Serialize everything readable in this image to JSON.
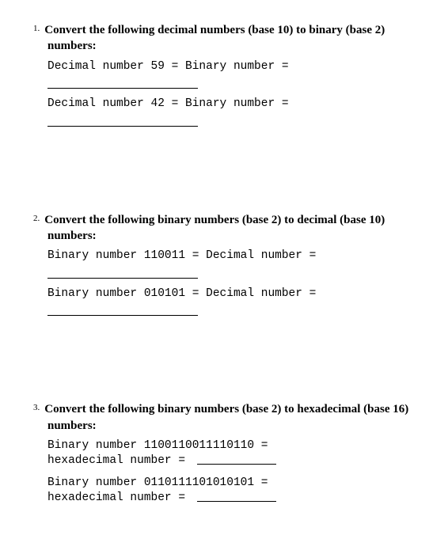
{
  "questions": [
    {
      "num": "1.",
      "title": "Convert the following decimal numbers (base 10) to binary (base 2) numbers:",
      "items": [
        {
          "line": "Decimal number 59 = Binary number ="
        },
        {
          "line": "Decimal number 42 = Binary number ="
        }
      ]
    },
    {
      "num": "2.",
      "title": "Convert the following binary numbers (base 2) to decimal (base 10) numbers:",
      "items": [
        {
          "line": "Binary number 110011 = Decimal number ="
        },
        {
          "line": "Binary number 010101 = Decimal number ="
        }
      ]
    },
    {
      "num": "3.",
      "title": "Convert the following binary numbers (base 2) to hexadecimal (base 16) numbers:",
      "items": [
        {
          "line1": "Binary number 1100110011110110 =",
          "line2": "hexadecimal number = "
        },
        {
          "line1": "Binary number 0110111101010101 =",
          "line2": "hexadecimal number = "
        }
      ]
    }
  ]
}
